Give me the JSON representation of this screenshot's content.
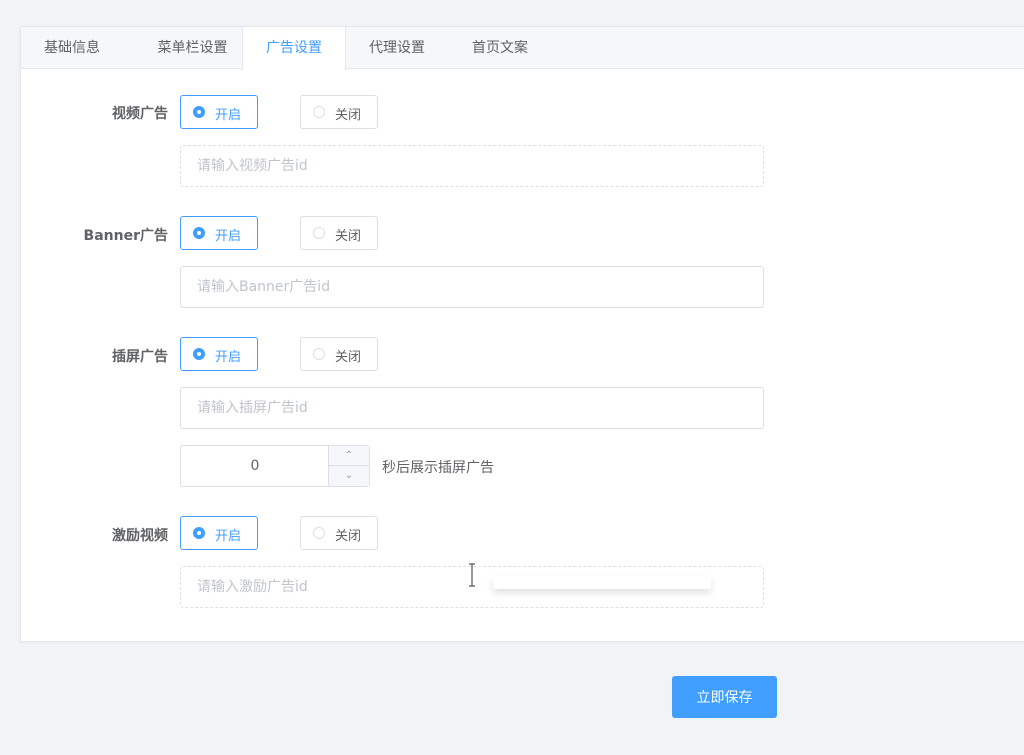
{
  "tabs": [
    {
      "label": "基础信息",
      "active": false
    },
    {
      "label": "菜单栏设置",
      "active": false
    },
    {
      "label": "广告设置",
      "active": true
    },
    {
      "label": "代理设置",
      "active": false
    },
    {
      "label": "首页文案",
      "active": false
    }
  ],
  "radio": {
    "on": "开启",
    "off": "关闭"
  },
  "sections": {
    "video": {
      "label": "视频广告",
      "placeholder": "请输入视频广告id",
      "value": "on"
    },
    "banner": {
      "label": "Banner广告",
      "placeholder": "请输入Banner广告id",
      "value": "on"
    },
    "interstitial": {
      "label": "插屏广告",
      "placeholder": "请输入插屏广告id",
      "value": "on"
    },
    "reward": {
      "label": "激励视频",
      "placeholder": "请输入激励广告id",
      "value": "on"
    }
  },
  "delay": {
    "value": "0",
    "suffix": "秒后展示插屏广告"
  },
  "save_label": "立即保存",
  "colors": {
    "accent": "#409eff",
    "border": "#dcdfe6",
    "placeholder": "#c0c4cc"
  },
  "icons": {
    "up": "chevron-up-icon",
    "down": "chevron-down-icon",
    "cursor": "text-cursor-icon"
  }
}
